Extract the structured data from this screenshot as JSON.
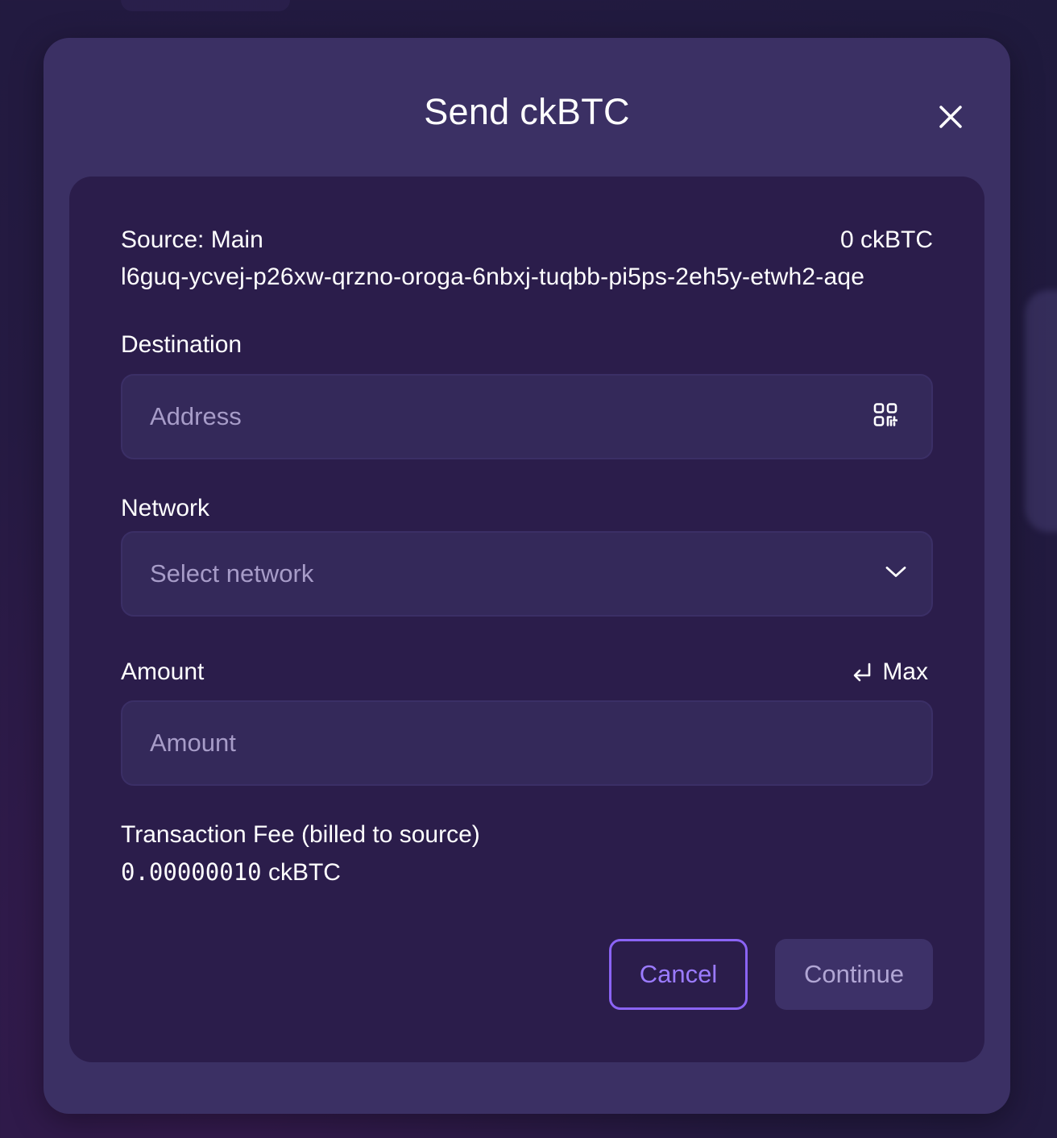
{
  "modal": {
    "title": "Send ckBTC",
    "close_icon": "close-icon"
  },
  "source": {
    "label": "Source: Main",
    "balance": "0 ckBTC",
    "address": "l6guq-ycvej-p26xw-qrzno-oroga-6nbxj-tuqbb-pi5ps-2eh5y-etwh2-aqe"
  },
  "destination": {
    "label": "Destination",
    "placeholder": "Address",
    "value": "",
    "icon": "qr-code-icon"
  },
  "network": {
    "label": "Network",
    "selected": "Select network",
    "icon": "chevron-down-icon"
  },
  "amount": {
    "label": "Amount",
    "max_label": "Max",
    "max_icon": "return-arrow-icon",
    "placeholder": "Amount",
    "value": ""
  },
  "fee": {
    "label": "Transaction Fee (billed to source)",
    "amount": "0.00000010",
    "unit": "ckBTC"
  },
  "buttons": {
    "cancel": "Cancel",
    "continue": "Continue"
  },
  "colors": {
    "accent": "#8b64f5",
    "modal_bg": "#3b3064",
    "panel_bg": "#2b1d4b",
    "field_bg": "#34295a"
  }
}
